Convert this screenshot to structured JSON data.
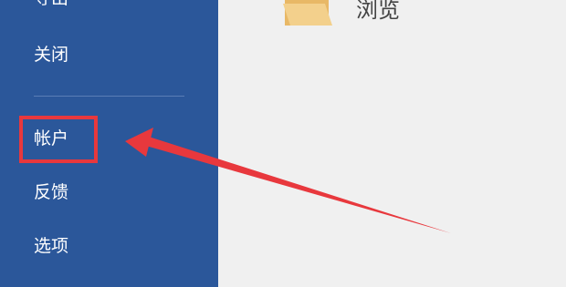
{
  "sidebar": {
    "items": [
      {
        "label": "导出"
      },
      {
        "label": "关闭"
      },
      {
        "label": "帐户"
      },
      {
        "label": "反馈"
      },
      {
        "label": "选项"
      }
    ]
  },
  "main": {
    "browse": {
      "label": "浏览",
      "icon": "folder-icon"
    }
  },
  "colors": {
    "sidebar_bg": "#2b579a",
    "main_bg": "#f0f0f0",
    "annotation": "#e8383d",
    "folder": "#f0c870"
  }
}
